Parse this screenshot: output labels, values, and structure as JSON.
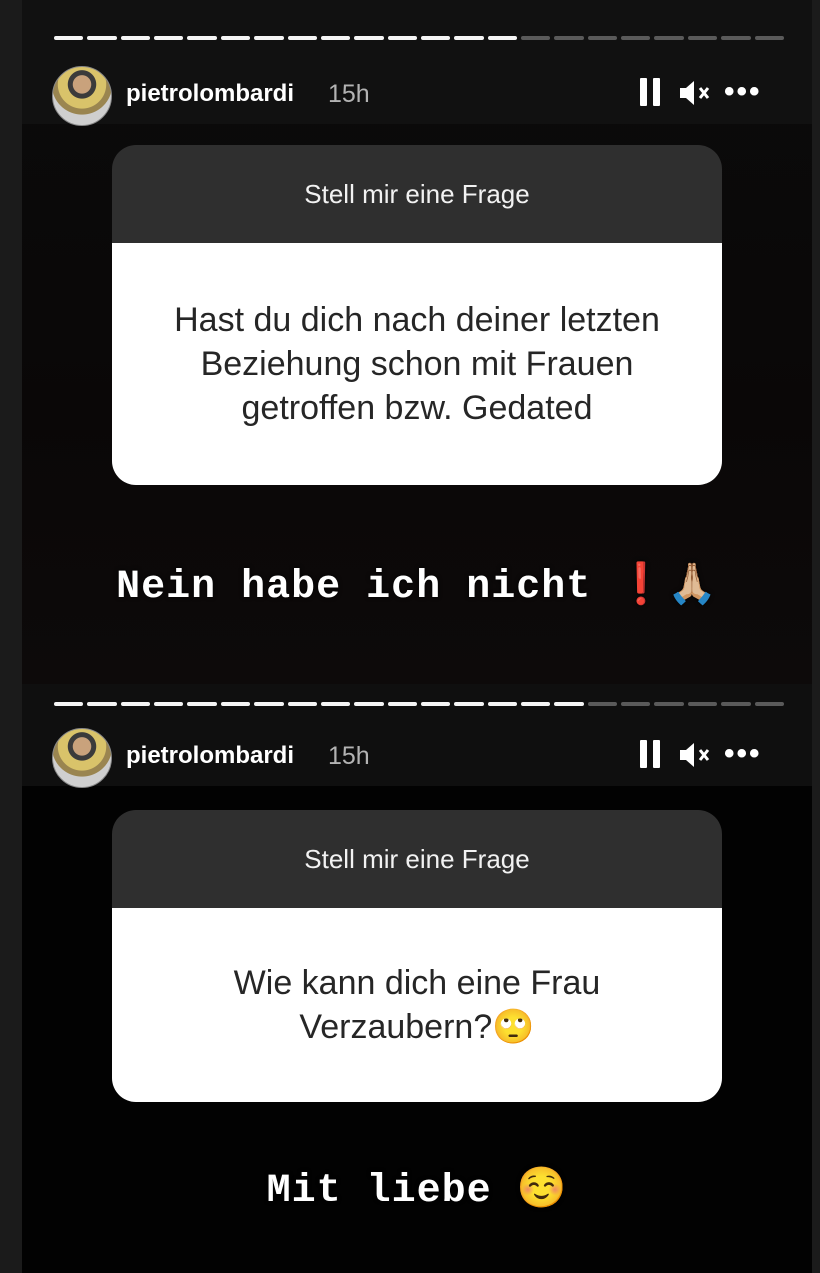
{
  "stories": [
    {
      "username": "pietrolombardi",
      "time": "15h",
      "progress_segments_done": 14,
      "progress_segments_total": 22,
      "question_header": "Stell mir eine Frage",
      "question": "Hast du dich nach deiner letzten Beziehung schon mit Frauen getroffen bzw. Gedated",
      "answer": "Nein habe ich nicht",
      "answer_emoji": "❗🙏🏼"
    },
    {
      "username": "pietrolombardi",
      "time": "15h",
      "progress_segments_done": 16,
      "progress_segments_total": 22,
      "question_header": "Stell mir eine Frage",
      "question": "Wie kann dich eine Frau Verzaubern?🙄",
      "answer": "Mit liebe",
      "answer_emoji": "☺️"
    }
  ],
  "icons": {
    "pause": "pause-icon",
    "mute": "speaker-muted-icon",
    "more": "more-options-icon",
    "more_glyph": "•••"
  },
  "colors": {
    "header_bar": "#2f2f2f",
    "card_body": "#ffffff",
    "progress_done": "#f5f5f5",
    "progress_pending": "#5a5a5a"
  }
}
